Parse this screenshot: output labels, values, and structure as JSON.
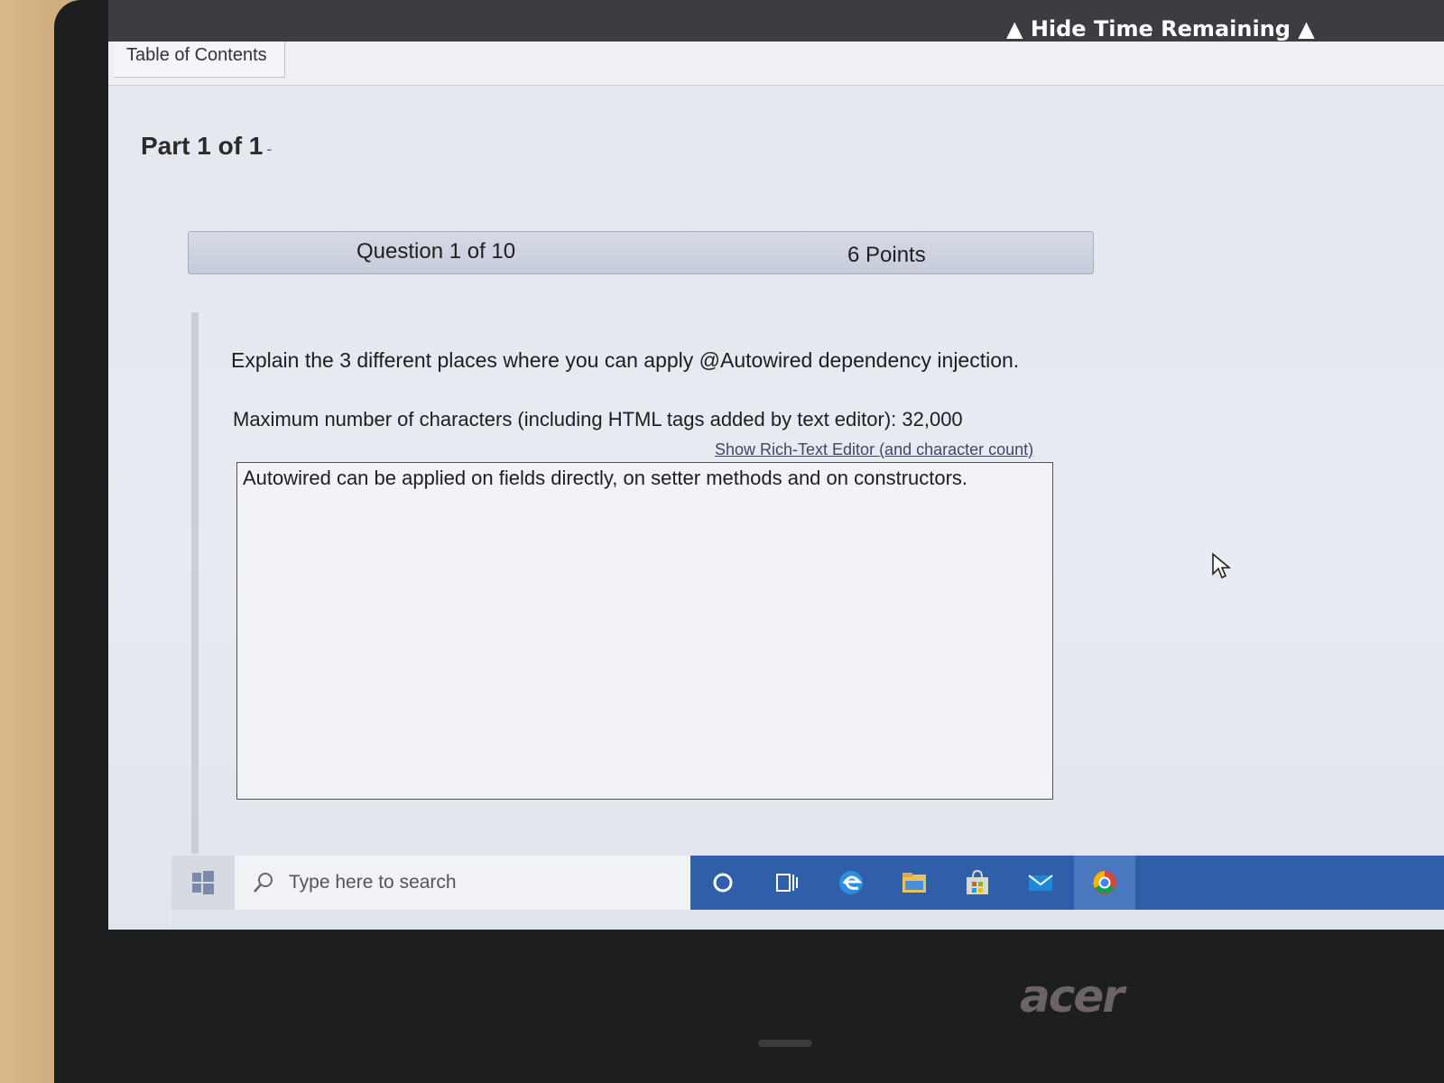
{
  "header": {
    "hide_time_label": "▲ Hide Time Remaining ▲",
    "toc_label": "Table of Contents"
  },
  "part": {
    "title": "Part 1 of 1",
    "dash": "-"
  },
  "question": {
    "number_label": "Question 1 of 10",
    "points_label": "6 Points",
    "prompt": "Explain the 3 different places where you can apply @Autowired dependency injection.",
    "max_chars_label": "Maximum number of characters (including HTML tags added by text editor): 32,000",
    "rich_text_link": "Show Rich-Text Editor (and character count)",
    "answer_text": "Autowired can be applied on fields directly, on setter methods and on constructors."
  },
  "taskbar": {
    "search_placeholder": "Type here to search",
    "icons": [
      "windows-start-icon",
      "search-icon",
      "cortana-icon",
      "task-view-icon",
      "edge-icon",
      "file-explorer-icon",
      "store-icon",
      "mail-icon",
      "chrome-icon"
    ]
  },
  "laptop": {
    "brand": "acer"
  },
  "colors": {
    "taskbar_blue": "#2f5fa8",
    "topbar": "#3b3d40",
    "question_bar": "#c7ccdb"
  }
}
